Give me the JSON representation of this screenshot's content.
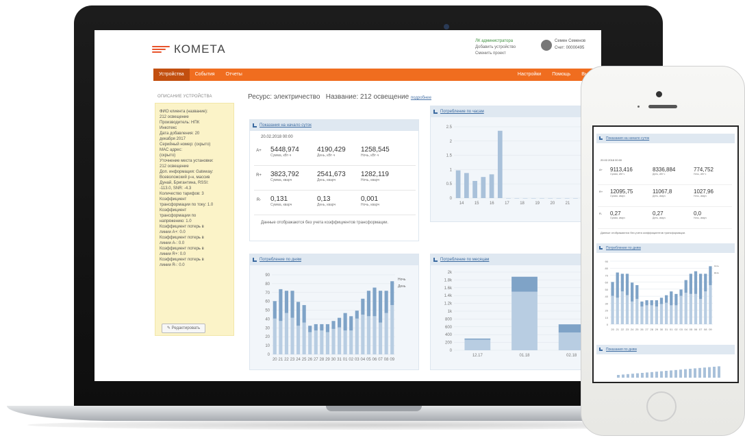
{
  "app": {
    "logo_text": "КОМЕТА",
    "header_links": [
      "ЛК администратора",
      "Добавить устройство",
      "Сменить проект"
    ],
    "user_name": "Семен Семенов",
    "user_account": "Счет: 00000495"
  },
  "nav": {
    "left": [
      "Устройства",
      "События",
      "Отчеты"
    ],
    "right": [
      "Настройки",
      "Помощь",
      "Выйти"
    ],
    "active": "Устройства"
  },
  "sidebar": {
    "title": "ОПИСАНИЕ УСТРОЙСТВА",
    "lines": [
      "ФИО клиента (название):",
      "212 освещение",
      "Производитель: НПК",
      "Инкотекс",
      "Дата добавления: 20",
      "декабря 2017",
      "Серийный номер: (скрыто)",
      "MAC адрес:",
      "(скрыто)",
      "Уточнение места установки:",
      "212 освещение",
      "Доп. информация: Gateway:",
      "Всеволожский р-н, массив",
      "Дунай, Бригантина, RSSI:",
      "-113.0, SNR: -4.3",
      "Количество тарифов: 3",
      "Коэффициент",
      "трансформации по току: 1.0",
      "Коэффициент",
      "трансформации по",
      "напряжению: 1.0",
      "Коэффициент потерь в",
      "линии А+: 0.0",
      "Коэффициент потерь в",
      "линии А-: 0.0",
      "Коэффициент потерь в",
      "линии R+: 0.0",
      "Коэффициент потерь в",
      "линии R-: 0.0"
    ],
    "edit_button": "Редактировать"
  },
  "resource": {
    "label": "Ресурс: электричество",
    "name_label": "Название:",
    "name_value": "212 освещение",
    "details_link": "подробнее"
  },
  "readings": {
    "title": "Показания на начало суток",
    "date": "20.02.2018 00:00",
    "rows": [
      {
        "label": "A+",
        "values": [
          "5448,974",
          "4190,429",
          "1258,545"
        ],
        "units": [
          "Сумма, кВт·ч",
          "День, кВт·ч",
          "Ночь, кВт·ч"
        ]
      },
      {
        "label": "R+",
        "values": [
          "3823,792",
          "2541,673",
          "1282,119"
        ],
        "units": [
          "Сумма, кварч",
          "День, кварч",
          "Ночь, кварч"
        ]
      },
      {
        "label": "R-",
        "values": [
          "0,131",
          "0,13",
          "0,001"
        ],
        "units": [
          "Сумма, кварч",
          "День, кварч",
          "Ночь, кварч"
        ]
      }
    ],
    "note": "Данные отображаются без учета коэффициентов трансформации."
  },
  "panels": {
    "hourly": "Потребление по часам",
    "daily": "Потребление по дням",
    "monthly": "Потребление по месяцам"
  },
  "chart_data": [
    {
      "type": "bar",
      "title": "Потребление по часам",
      "categories": [
        "14",
        "15",
        "16",
        "17",
        "18",
        "19",
        "20",
        "21",
        "22"
      ],
      "yticks": [
        "0",
        "0.5",
        "1",
        "1.5",
        "2",
        "2.5"
      ],
      "ylim": [
        0,
        2.7
      ],
      "values": [
        1.05,
        0.95,
        0.65,
        0.8,
        0.9,
        2.55,
        0.0,
        0.0,
        0.0,
        0.0,
        0.0,
        0.0,
        0.0,
        0.0,
        0.0,
        0.0,
        0.0
      ]
    },
    {
      "type": "bar",
      "title": "Потребление по дням",
      "categories": [
        "20",
        "21",
        "22",
        "23",
        "24",
        "25",
        "26",
        "27",
        "28",
        "29",
        "30",
        "31",
        "01",
        "02",
        "03",
        "04",
        "05",
        "06",
        "07",
        "08",
        "09"
      ],
      "yticks": [
        "0",
        "10",
        "20",
        "30",
        "40",
        "50",
        "60",
        "70",
        "80",
        "90"
      ],
      "ylim": [
        0,
        100
      ],
      "series": [
        {
          "name": "Ночь",
          "values": [
            45,
            42,
            52,
            46,
            36,
            40,
            28,
            30,
            30,
            28,
            32,
            34,
            30,
            30,
            45,
            50,
            48,
            48,
            40,
            52,
            62
          ]
        },
        {
          "name": "День",
          "values": [
            22,
            40,
            28,
            34,
            30,
            22,
            8,
            8,
            8,
            10,
            10,
            12,
            22,
            18,
            10,
            20,
            32,
            36,
            40,
            28,
            30
          ]
        }
      ]
    },
    {
      "type": "bar",
      "title": "Потребление по месяцам",
      "categories": [
        "12.17",
        "01.18",
        "02.18"
      ],
      "yticks": [
        "0",
        "200",
        "400",
        "600",
        "800",
        "1k",
        "1.2k",
        "1.4k",
        "1.6k",
        "1.8k",
        "2k"
      ],
      "ylim": [
        0,
        2200
      ],
      "series": [
        {
          "name": "Ночь",
          "values": [
            300,
            1650,
            500
          ]
        },
        {
          "name": "День",
          "values": [
            30,
            420,
            230
          ]
        }
      ]
    }
  ],
  "phone": {
    "readings_title": "Показания на начало суток",
    "date": "20.02.2018 00:00",
    "rows": [
      {
        "label": "A+",
        "values": [
          "9113,416",
          "8336,884",
          "774,752"
        ],
        "units": [
          "Сумма, кВт·ч",
          "День, кВт·ч",
          "Ночь, кВт·ч"
        ]
      },
      {
        "label": "R+",
        "values": [
          "12095,75",
          "11067,8",
          "1027,96"
        ],
        "units": [
          "Сумма, кварч",
          "День, кварч",
          "Ночь, кварч"
        ]
      },
      {
        "label": "R-",
        "values": [
          "0,27",
          "0,27",
          "0,0"
        ],
        "units": [
          "Сумма, кварч",
          "День, кварч",
          "Ночь, кварч"
        ]
      }
    ],
    "note": "Данные отображаются без учета коэффициентов трансформации.",
    "daily_title": "Потребление по дням",
    "third_title": "Показания по дням"
  }
}
